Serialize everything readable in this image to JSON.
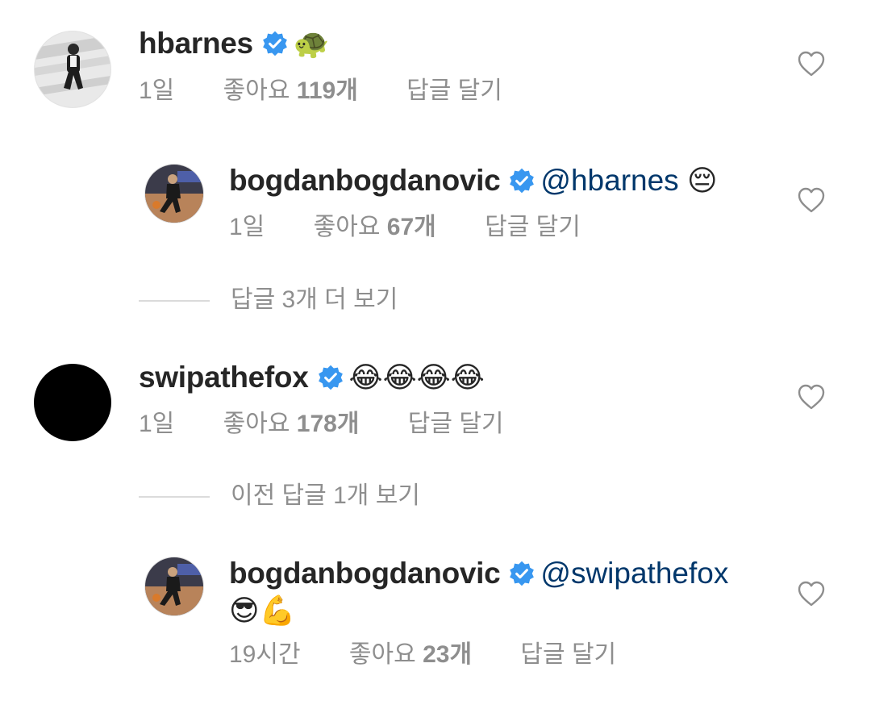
{
  "comments": [
    {
      "username": "hbarnes",
      "text": "🐢",
      "time": "1일",
      "likes_label": "좋아요",
      "likes_count": "119개",
      "reply_label": "답글 달기"
    },
    {
      "username": "bogdanbogdanovic",
      "mention": "@hbarnes",
      "text": "😔",
      "time": "1일",
      "likes_label": "좋아요",
      "likes_count": "67개",
      "reply_label": "답글 달기"
    },
    {
      "username": "swipathefox",
      "text": "😂😂😂😂",
      "time": "1일",
      "likes_label": "좋아요",
      "likes_count": "178개",
      "reply_label": "답글 달기"
    },
    {
      "username": "bogdanbogdanovic",
      "mention": "@swipathefox",
      "text": "😎💪",
      "time": "19시간",
      "likes_label": "좋아요",
      "likes_count": "23개",
      "reply_label": "답글 달기"
    }
  ],
  "view_more_replies": [
    "답글 3개 더 보기",
    "이전 답글 1개 보기"
  ],
  "icons": {
    "verified_color": "#3897f0",
    "heart_outline_color": "#8e8e8e"
  }
}
